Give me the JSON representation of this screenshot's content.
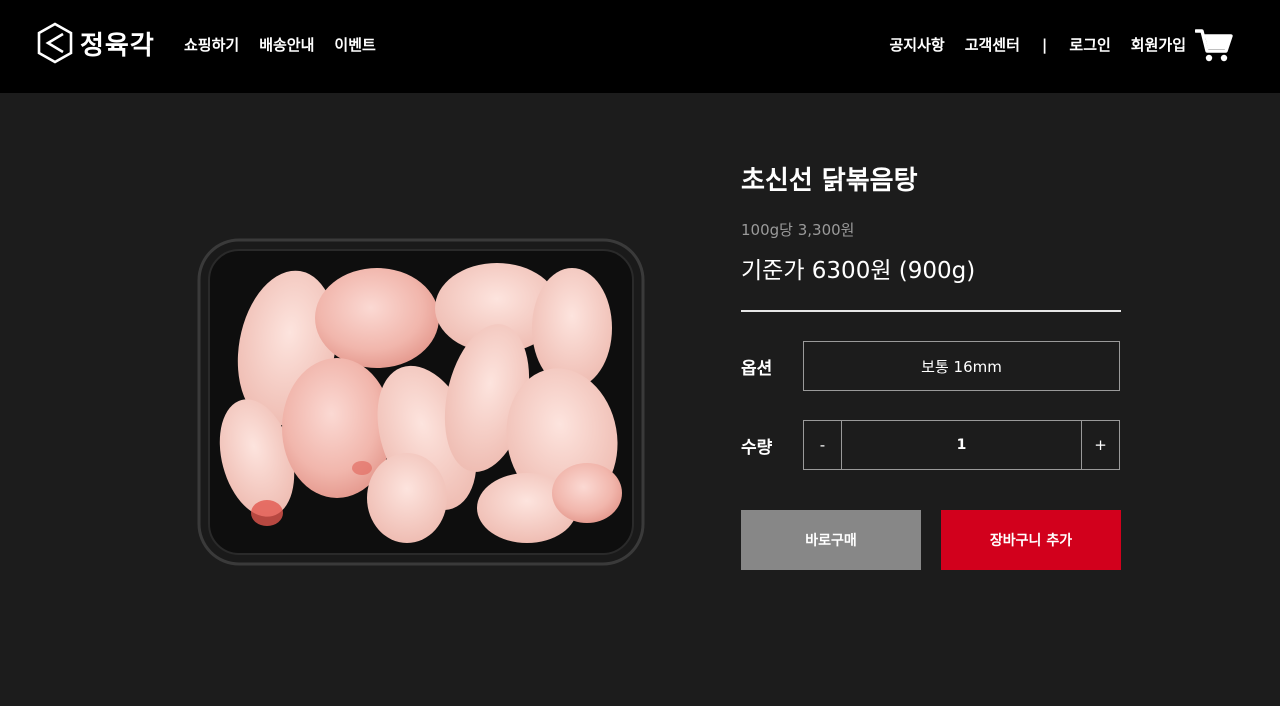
{
  "brand": {
    "name": "정육각"
  },
  "nav": {
    "left": [
      "쇼핑하기",
      "배송안내",
      "이벤트"
    ],
    "right": [
      "공지사항",
      "고객센터"
    ],
    "separator": "|",
    "auth": [
      "로그인",
      "회원가입"
    ]
  },
  "icons": {
    "logo": "hexagon-logo-icon",
    "cart": "shopping-cart-icon"
  },
  "product": {
    "title": "초신선 닭볶음탕",
    "unit_price": "100g당 3,300원",
    "base_price": "기준가 6300원 (900g)",
    "image_alt": "chicken-pieces-in-black-tray"
  },
  "options": {
    "option_label": "옵션",
    "option_value": "보통 16mm",
    "quantity_label": "수량",
    "quantity_value": "1",
    "minus": "-",
    "plus": "+"
  },
  "actions": {
    "buy_now": "바로구매",
    "add_to_cart": "장바구니 추가"
  },
  "colors": {
    "header_bg": "#000000",
    "page_bg": "#1c1c1c",
    "buy_btn": "#878787",
    "cart_btn": "#d2001c"
  }
}
